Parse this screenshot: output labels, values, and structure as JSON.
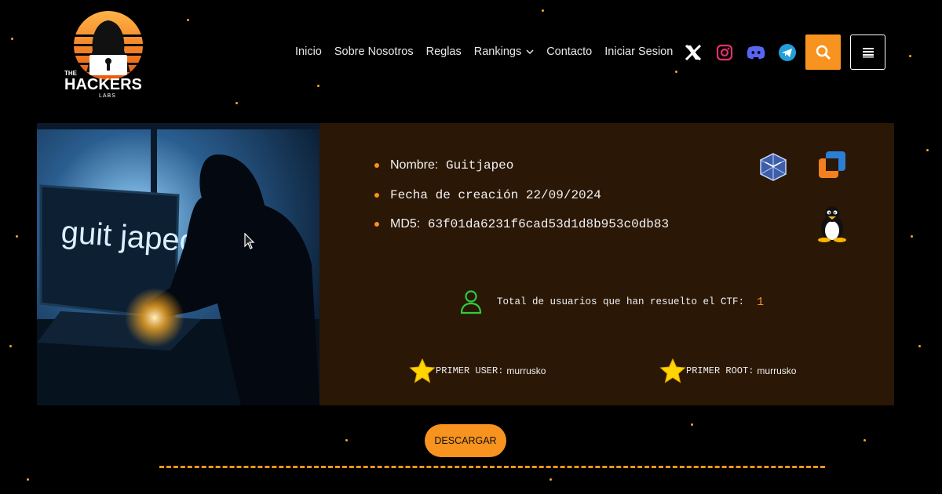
{
  "brand": {
    "logo_top": "THE",
    "logo_main": "HACKERS",
    "logo_sub": "LABS"
  },
  "nav": {
    "items": [
      {
        "label": "Inicio"
      },
      {
        "label": "Sobre Nosotros"
      },
      {
        "label": "Reglas"
      },
      {
        "label": "Rankings"
      },
      {
        "label": "Contacto"
      },
      {
        "label": "Iniciar Sesion"
      }
    ]
  },
  "socials": [
    "x-icon",
    "instagram-icon",
    "discord-icon",
    "telegram-icon"
  ],
  "machine": {
    "image_text": "guit japeo",
    "name_label": "Nombre:",
    "name": "Guitjapeo",
    "date_label": "Fecha de creación",
    "date": "22/09/2024",
    "md5_label": "MD5:",
    "md5": "63f01da6231f6cad53d1d8b953c0db83",
    "platforms": [
      "virtualbox-icon",
      "vmware-icon"
    ],
    "os": "linux-icon"
  },
  "stats": {
    "users_label": "Total de usuarios que han resuelto el CTF:",
    "users_count": "1",
    "first_user_label": "PRIMER USER:",
    "first_user": "murrusko",
    "first_root_label": "PRIMER ROOT:",
    "first_root": "murrusko"
  },
  "actions": {
    "download_label": "DESCARGAR"
  },
  "colors": {
    "accent": "#f7931e",
    "panel": "#2a1705",
    "background": "#000000",
    "user_icon": "#2ecc40"
  }
}
